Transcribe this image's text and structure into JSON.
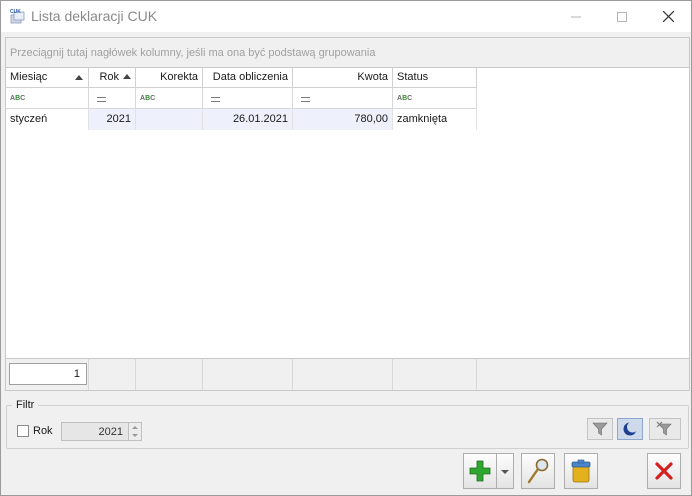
{
  "window": {
    "title": "Lista deklaracji CUK",
    "app_icon_text": "CUK"
  },
  "grid": {
    "group_hint": "Przeciągnij tutaj nagłówek kolumny, jeśli ma ona być podstawą grupowania",
    "columns": [
      {
        "label": "Miesiąc",
        "sorted": "asc",
        "filter": "text"
      },
      {
        "label": "Rok",
        "sorted": "asc",
        "filter": "equals"
      },
      {
        "label": "Korekta",
        "filter": "text"
      },
      {
        "label": "Data obliczenia",
        "filter": "equals"
      },
      {
        "label": "Kwota",
        "filter": "equals"
      },
      {
        "label": "Status",
        "filter": "text"
      }
    ],
    "filter_text_glyph": "ABC",
    "rows": [
      {
        "miesiac": "styczeń",
        "rok": "2021",
        "korekta": "",
        "data_obliczenia": "26.01.2021",
        "kwota": "780,00",
        "status": "zamknięta"
      }
    ],
    "footer_count": "1"
  },
  "filter_panel": {
    "legend": "Filtr",
    "rok_label": "Rok",
    "rok_checked": false,
    "rok_value": "2021"
  },
  "colors": {
    "accent_green": "#2fa62f",
    "delete_red": "#d42020",
    "selected_row": "#eef0fb"
  },
  "icons": [
    "filter-icon",
    "moon-filter-icon",
    "clear-filter-icon",
    "add-icon",
    "preview-icon",
    "delete-icon",
    "cancel-icon"
  ]
}
